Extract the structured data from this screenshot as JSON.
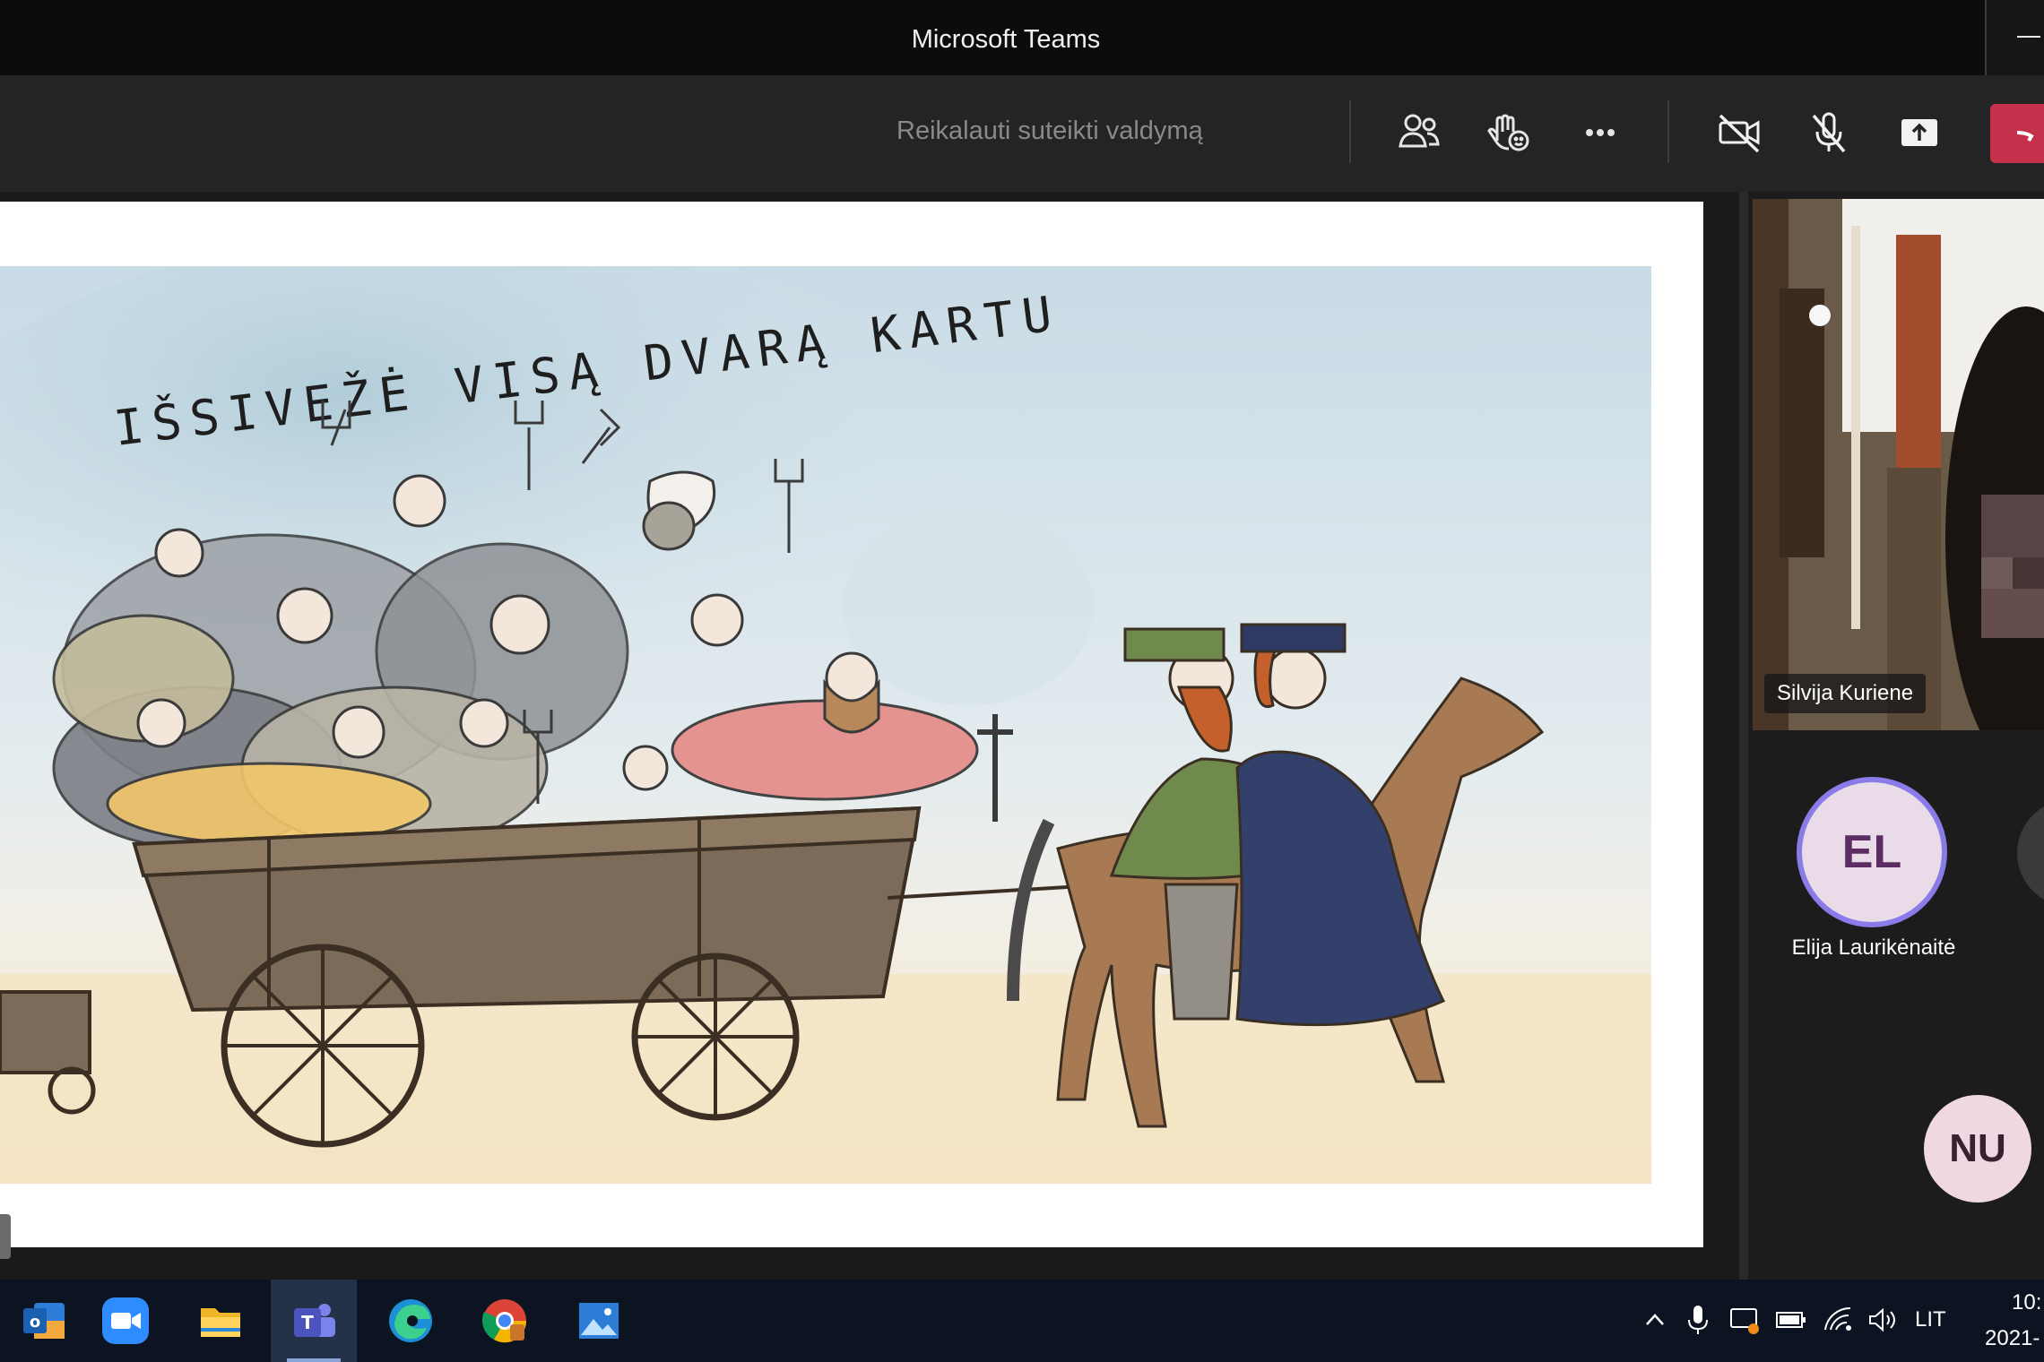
{
  "window": {
    "title": "Microsoft Teams",
    "minimize_icon": "minimize-icon"
  },
  "toolbar": {
    "request_control": "Reikalauti suteikti valdymą",
    "buttons": [
      {
        "icon": "people-icon"
      },
      {
        "icon": "raise-hand-react-icon"
      },
      {
        "icon": "more-options-icon"
      },
      {
        "icon": "camera-off-icon"
      },
      {
        "icon": "mic-off-icon"
      },
      {
        "icon": "share-screen-icon"
      },
      {
        "icon": "hang-up-icon",
        "color": "#c4314b"
      }
    ]
  },
  "slide": {
    "heading": "IŠSIVEŽĖ VISĄ DVARĄ KARTU"
  },
  "participants": {
    "video": {
      "name": "Silvija Kuriene"
    },
    "avatars": [
      {
        "initials": "EL",
        "name": "Elija Laurikėnaitė",
        "color": "#e9dce8",
        "ring": "#8a7ce8"
      },
      {
        "initials": "NU",
        "color": "#f0d8e2"
      }
    ]
  },
  "taskbar": {
    "apps": [
      {
        "icon": "outlook-icon"
      },
      {
        "icon": "zoom-icon"
      },
      {
        "icon": "file-explorer-icon"
      },
      {
        "icon": "teams-icon",
        "active": true
      },
      {
        "icon": "edge-icon"
      },
      {
        "icon": "chrome-icon"
      },
      {
        "icon": "photos-icon"
      }
    ],
    "tray": {
      "icons": [
        "chevron-up-icon",
        "microphone-icon",
        "remote-icon",
        "battery-icon",
        "wifi-icon",
        "volume-icon"
      ],
      "language": "LIT",
      "time": "10:",
      "date": "2021-"
    }
  }
}
